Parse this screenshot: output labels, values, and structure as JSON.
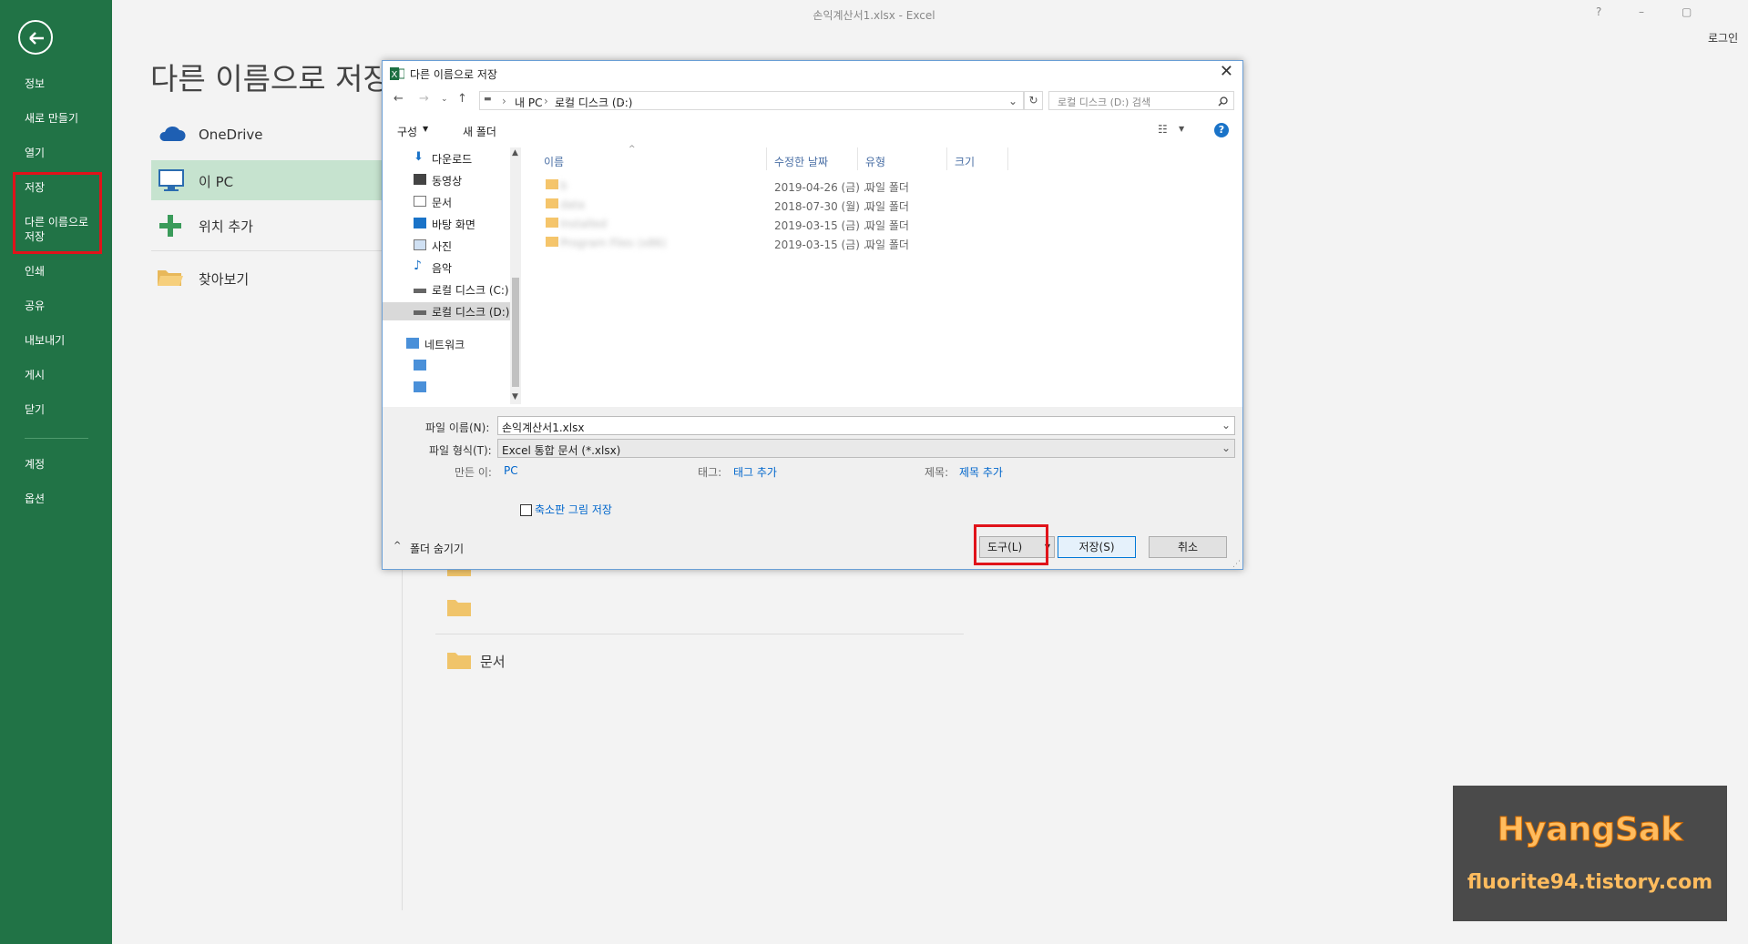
{
  "window": {
    "title": "손익계산서1.xlsx - Excel",
    "help": "?",
    "min": "–",
    "restore": "▢",
    "login": "로그인"
  },
  "backstage": {
    "items": [
      {
        "label": "정보"
      },
      {
        "label": "새로 만들기"
      },
      {
        "label": "열기"
      },
      {
        "label": "저장"
      },
      {
        "label": "다른 이름으로"
      },
      {
        "label": "저장"
      },
      {
        "label": "인쇄"
      },
      {
        "label": "공유"
      },
      {
        "label": "내보내기"
      },
      {
        "label": "게시"
      },
      {
        "label": "닫기"
      },
      {
        "label": "계정"
      },
      {
        "label": "옵션"
      }
    ]
  },
  "saveas": {
    "title": "다른 이름으로 저장",
    "locations": [
      {
        "label": "OneDrive"
      },
      {
        "label": "이 PC"
      },
      {
        "label": "위치 추가"
      },
      {
        "label": "찾아보기"
      }
    ],
    "bg_folder_label": "문서"
  },
  "dialog": {
    "title": "다른 이름으로 저장",
    "close": "✕",
    "address": {
      "crumbs": [
        "내 PC",
        "로컬 디스크 (D:)"
      ]
    },
    "search_placeholder": "로컬 디스크 (D:) 검색",
    "toolbar": {
      "organize": "구성",
      "new_folder": "새 폴더"
    },
    "tree": [
      {
        "label": "다운로드"
      },
      {
        "label": "동영상"
      },
      {
        "label": "문서"
      },
      {
        "label": "바탕 화면"
      },
      {
        "label": "사진"
      },
      {
        "label": "음악"
      },
      {
        "label": "로컬 디스크 (C:)"
      },
      {
        "label": "로컬 디스크 (D:)"
      },
      {
        "label": "네트워크"
      }
    ],
    "columns": {
      "name": "이름",
      "date": "수정한 날짜",
      "type": "유형",
      "size": "크기"
    },
    "rows": [
      {
        "name": "b",
        "date": "2019-04-26 (금) ...",
        "type": "파일 폴더"
      },
      {
        "name": "data",
        "date": "2018-07-30 (월) ...",
        "type": "파일 폴더"
      },
      {
        "name": "Installed",
        "date": "2019-03-15 (금) ...",
        "type": "파일 폴더"
      },
      {
        "name": "Program Files (x86)",
        "date": "2019-03-15 (금) ...",
        "type": "파일 폴더"
      }
    ],
    "filename": {
      "label": "파일 이름(N):",
      "value": "손익계산서1.xlsx"
    },
    "filetype": {
      "label": "파일 형식(T):",
      "value": "Excel 통합 문서 (*.xlsx)"
    },
    "author": {
      "label": "만든 이:",
      "value": "PC"
    },
    "tags": {
      "label": "태그:",
      "value": "태그 추가"
    },
    "subject": {
      "label": "제목:",
      "value": "제목 추가"
    },
    "thumbnail": "축소판 그림 저장",
    "hide_folders": "폴더 숨기기",
    "tools": "도구(L)",
    "save": "저장(S)",
    "cancel": "취소"
  },
  "watermark": {
    "line1": "HyangSak",
    "line2": "fluorite94.tistory.com"
  },
  "colors": {
    "excel_green": "#217346",
    "highlight_red": "#e0131a",
    "selected_location": "#c6e3cf",
    "link_blue": "#0066cc"
  }
}
